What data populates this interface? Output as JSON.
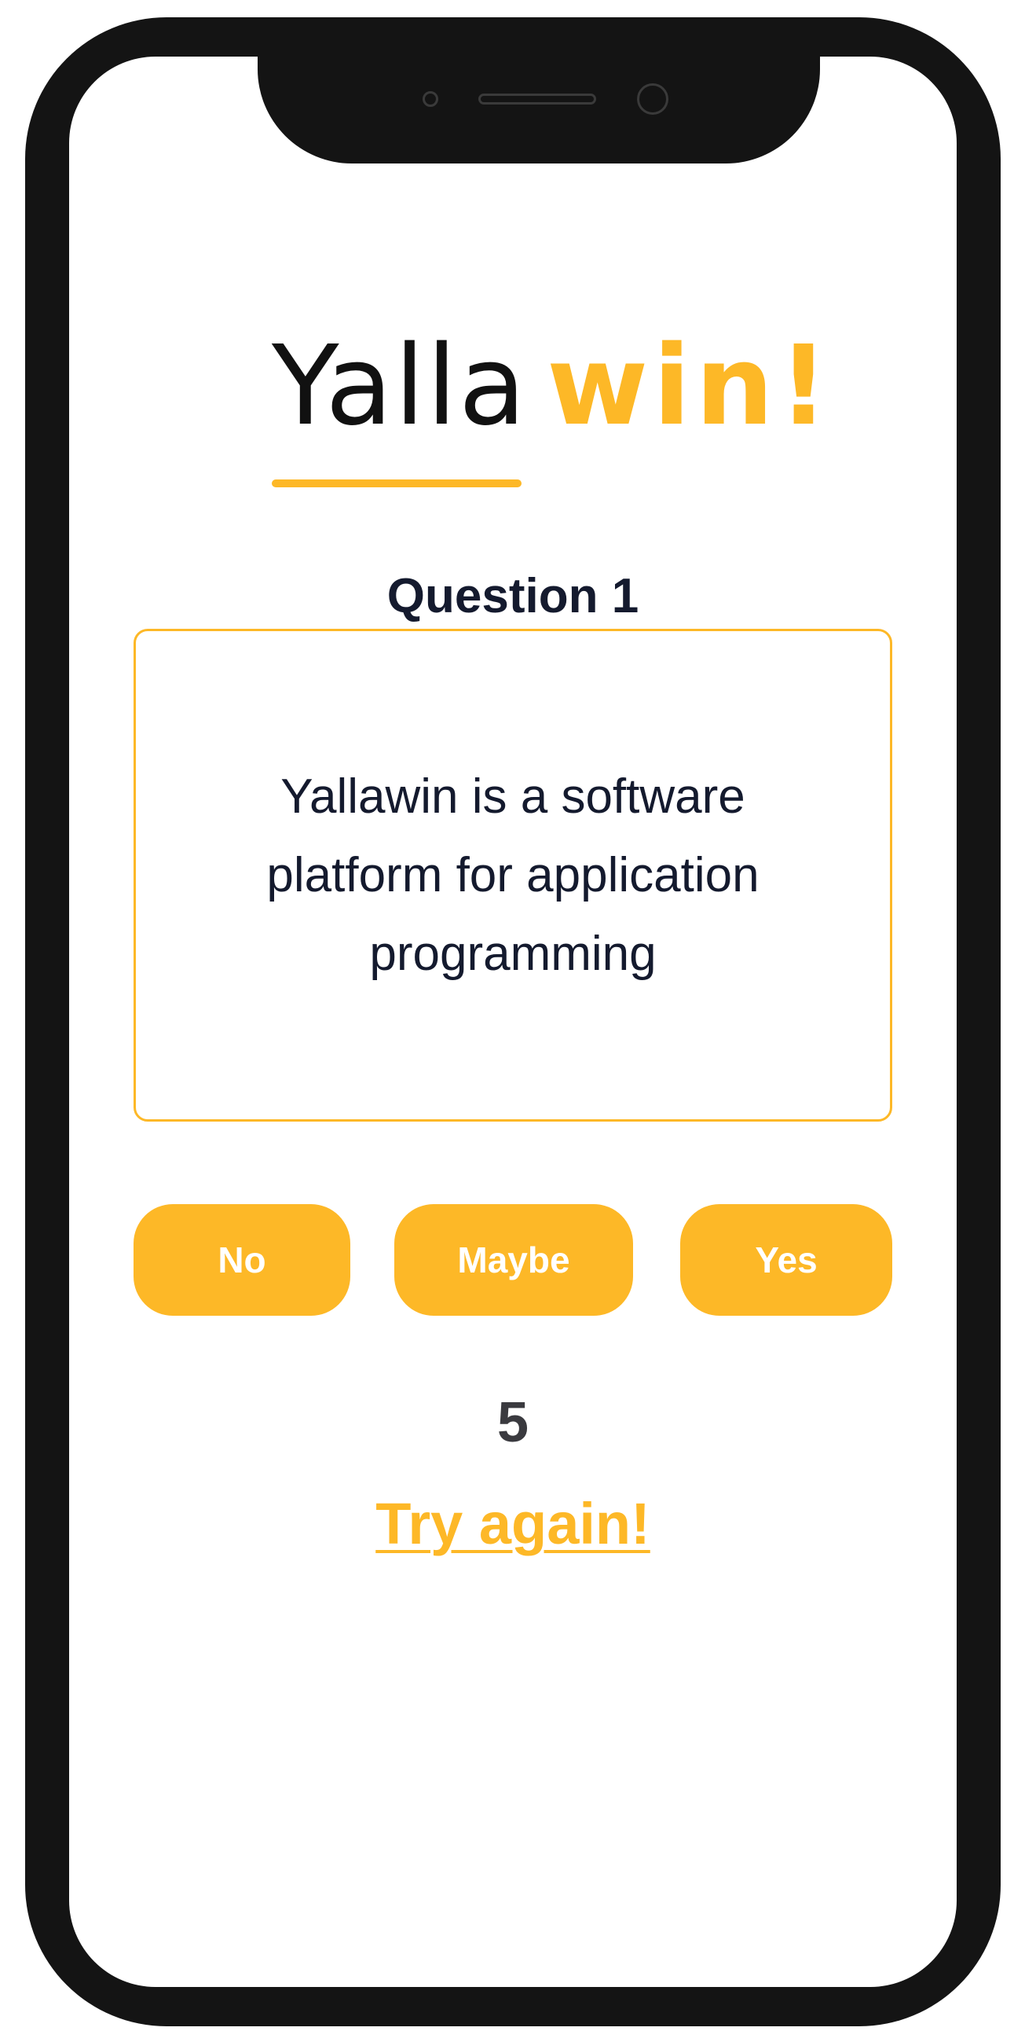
{
  "logo": {
    "part1": "Yalla",
    "part2": "win!"
  },
  "question": {
    "title": "Question 1",
    "text": "Yallawin is a software platform for application programming"
  },
  "answers": {
    "no": "No",
    "maybe": "Maybe",
    "yes": "Yes"
  },
  "timer": {
    "value": "5"
  },
  "actions": {
    "try_again": "Try again!"
  },
  "colors": {
    "accent": "#fdb827",
    "text_dark": "#141a2e",
    "frame": "#141414"
  }
}
